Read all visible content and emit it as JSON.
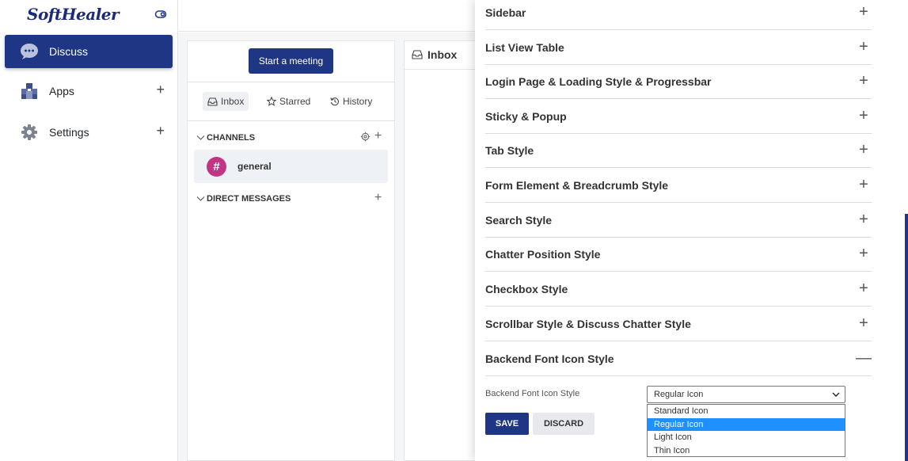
{
  "sidebar": {
    "logo": "SoftHealer",
    "items": [
      {
        "label": "Discuss",
        "icon": "chat-bubble-icon",
        "active": true
      },
      {
        "label": "Apps",
        "icon": "apps-cubes-icon",
        "expand": "+"
      },
      {
        "label": "Settings",
        "icon": "gear-icon",
        "expand": "+"
      }
    ]
  },
  "discuss": {
    "meeting_button": "Start a meeting",
    "tabs": [
      {
        "label": "Inbox",
        "icon": "inbox-icon",
        "active": true
      },
      {
        "label": "Starred",
        "icon": "star-icon"
      },
      {
        "label": "History",
        "icon": "history-icon"
      }
    ],
    "channels_heading": "CHANNELS",
    "channels": [
      {
        "name": "general",
        "symbol": "#"
      }
    ],
    "direct_messages_heading": "DIRECT MESSAGES",
    "add_symbol": "+"
  },
  "inbox": {
    "title": "Inbox"
  },
  "settings": {
    "sections": [
      {
        "title": "Sidebar",
        "sign": "+"
      },
      {
        "title": "List View Table",
        "sign": "+"
      },
      {
        "title": "Login Page & Loading Style & Progressbar",
        "sign": "+"
      },
      {
        "title": "Sticky & Popup",
        "sign": "+"
      },
      {
        "title": "Tab Style",
        "sign": "+"
      },
      {
        "title": "Form Element & Breadcrumb Style",
        "sign": "+"
      },
      {
        "title": "Search Style",
        "sign": "+"
      },
      {
        "title": "Chatter Position Style",
        "sign": "+"
      },
      {
        "title": "Checkbox Style",
        "sign": "+"
      },
      {
        "title": "Scrollbar Style & Discuss Chatter Style",
        "sign": "+"
      },
      {
        "title": "Backend Font Icon Style",
        "sign": "—"
      }
    ],
    "field_label": "Backend Font Icon Style",
    "select_value": "Regular Icon",
    "options": [
      "Standard Icon",
      "Regular Icon",
      "Light Icon",
      "Thin Icon"
    ],
    "selected_index": 1,
    "save_label": "SAVE",
    "discard_label": "DISCARD"
  },
  "colors": {
    "primary": "#1f3684",
    "channel_avatar": "#c13584",
    "option_highlight": "#1e90ff"
  }
}
